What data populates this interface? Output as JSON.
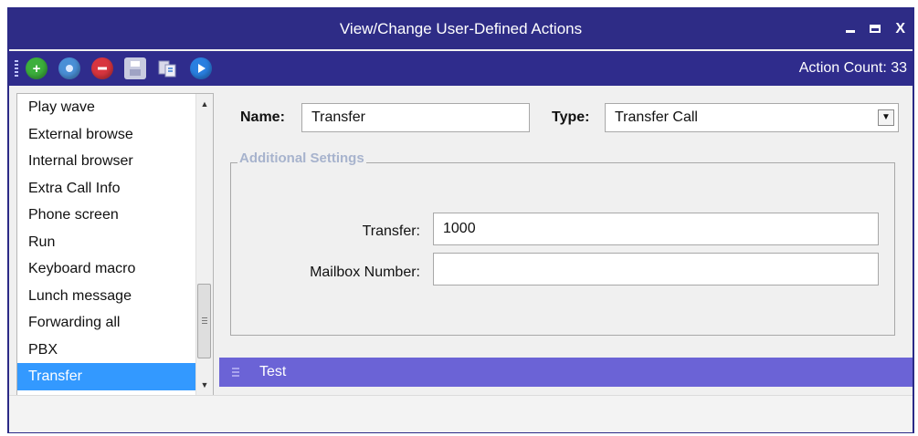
{
  "window": {
    "title": "View/Change User-Defined Actions",
    "minimize_glyph": "",
    "close_glyph": "X"
  },
  "toolbar": {
    "icons": [
      "add-icon",
      "edit-icon",
      "delete-icon",
      "save-icon",
      "copy-icon",
      "run-icon"
    ],
    "action_count_label": "Action Count: 33"
  },
  "actions_list": {
    "items": [
      "Play wave",
      "External browse",
      "Internal browser",
      "Extra Call Info",
      "Phone screen",
      "Run",
      "Keyboard macro",
      "Lunch message",
      "Forwarding all",
      "PBX",
      "Transfer"
    ],
    "selected": "Transfer"
  },
  "form": {
    "name_label": "Name:",
    "name_value": "Transfer",
    "type_label": "Type:",
    "type_value": "Transfer Call"
  },
  "additional_settings": {
    "legend": "Additional Settings",
    "transfer_label": "Transfer:",
    "transfer_value": "1000",
    "mailbox_label": "Mailbox Number:",
    "mailbox_value": ""
  },
  "test_panel": {
    "label": "Test"
  },
  "colors": {
    "titlebar": "#2e2c86",
    "selection": "#3399ff",
    "test_bar": "#6b63d6",
    "legend_text": "#a7b3cd"
  }
}
